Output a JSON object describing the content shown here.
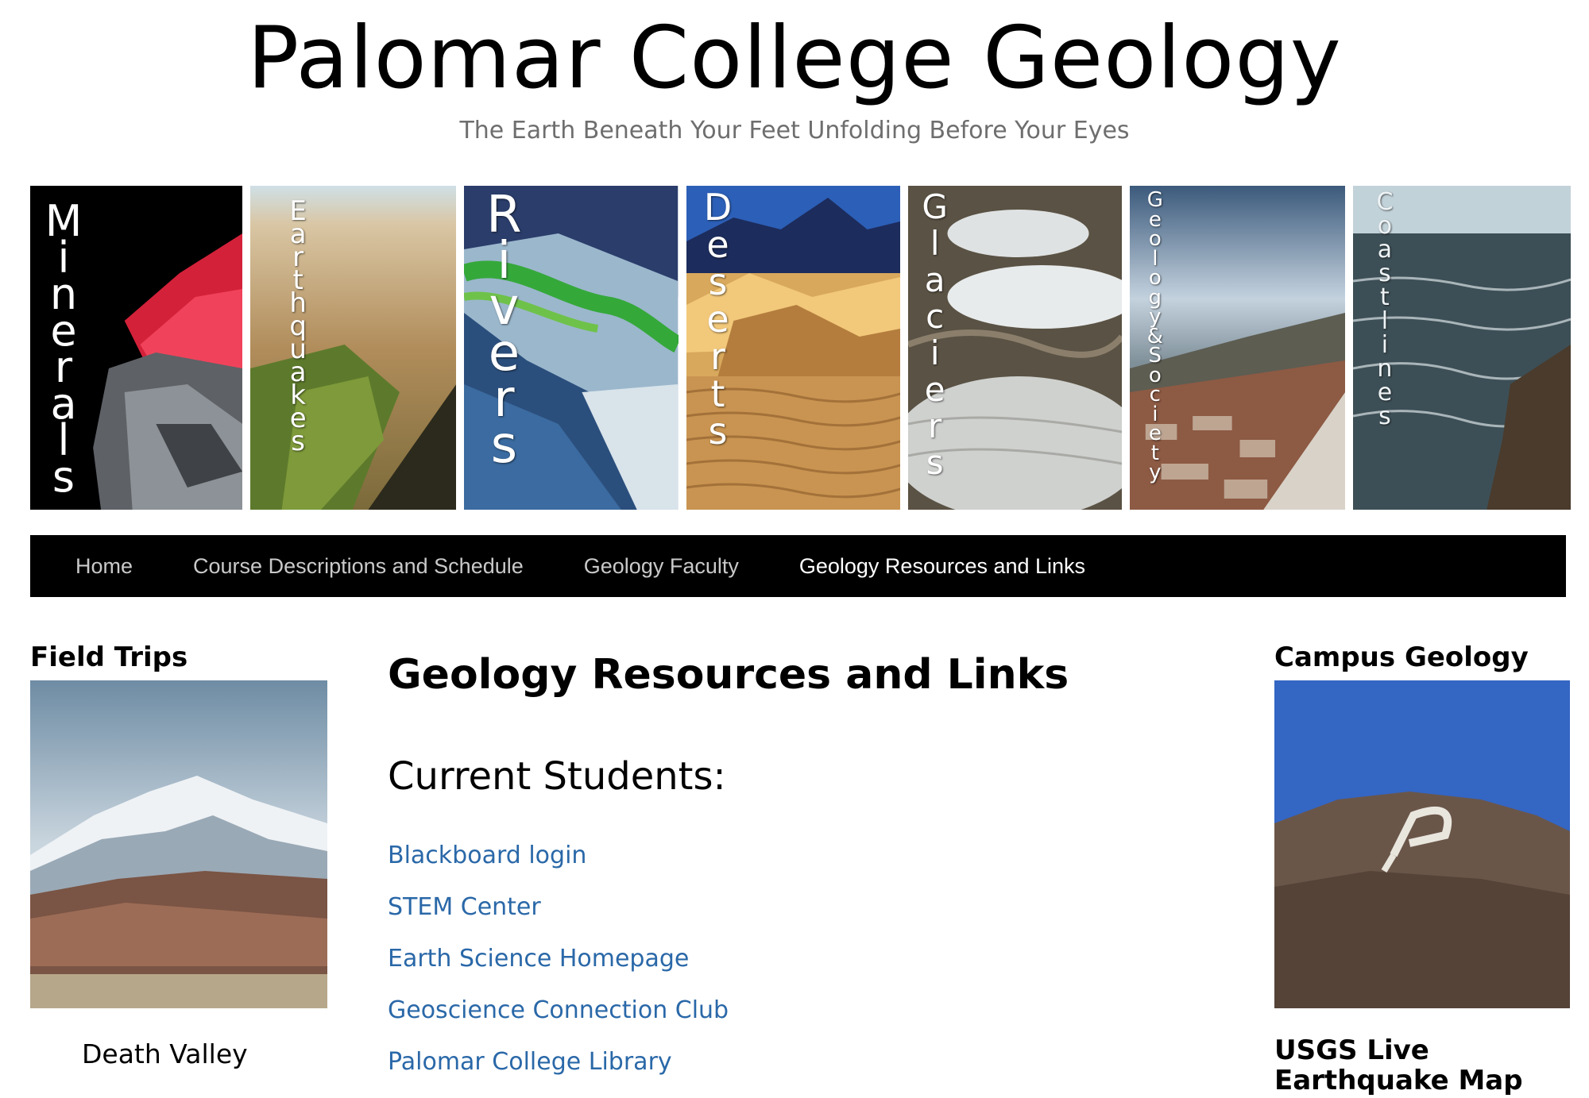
{
  "header": {
    "title": "Palomar College Geology",
    "tagline": "The Earth Beneath Your Feet Unfolding Before Your Eyes"
  },
  "banner": {
    "panels": [
      {
        "label": "Minerals",
        "icon": "minerals-image"
      },
      {
        "label": "Earthquakes",
        "icon": "earthquakes-image"
      },
      {
        "label": "Rivers",
        "icon": "rivers-image"
      },
      {
        "label": "Deserts",
        "icon": "deserts-image"
      },
      {
        "label": "Glaciers",
        "icon": "glaciers-image"
      },
      {
        "label": "Geology&Society",
        "icon": "geology-society-image"
      },
      {
        "label": "Coastlines",
        "icon": "coastlines-image"
      }
    ]
  },
  "nav": {
    "items": [
      {
        "label": "Home",
        "active": false
      },
      {
        "label": "Course Descriptions and Schedule",
        "active": false
      },
      {
        "label": "Geology Faculty",
        "active": false
      },
      {
        "label": "Geology Resources and Links",
        "active": true
      }
    ]
  },
  "left_sidebar": {
    "title": "Field Trips",
    "caption": "Death Valley"
  },
  "main": {
    "title": "Geology Resources and Links",
    "section_title": "Current Students:",
    "links": [
      "Blackboard login",
      "STEM Center",
      "Earth Science Homepage",
      "Geoscience Connection Club",
      "Palomar College Library"
    ]
  },
  "right_sidebar": {
    "title": "Campus Geology",
    "second_title": "USGS Live Earthquake Map"
  },
  "colors": {
    "nav_bg": "#000000",
    "link": "#2a68a8",
    "tagline": "#6e6e6e"
  }
}
